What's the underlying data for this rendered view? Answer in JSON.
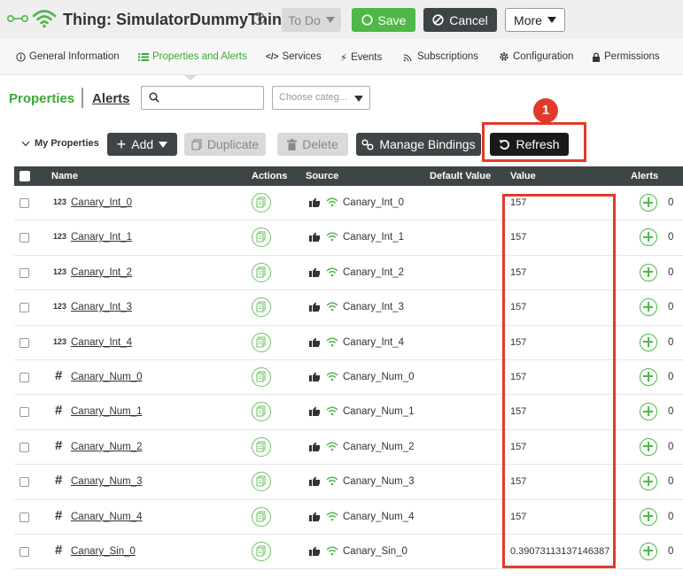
{
  "header": {
    "title": "Thing: SimulatorDummyThing",
    "help_glyph": "?",
    "todo_label": "To Do",
    "save_label": "Save",
    "cancel_label": "Cancel",
    "more_label": "More",
    "accent_color": "#4fb848",
    "dark_color": "#3f4547"
  },
  "tabs": [
    {
      "label": "General Information",
      "icon": "info-icon"
    },
    {
      "label": "Properties and Alerts",
      "icon": "list-icon",
      "active": true
    },
    {
      "label": "Services",
      "icon": "code-icon"
    },
    {
      "label": "Events",
      "icon": "bolt-icon"
    },
    {
      "label": "Subscriptions",
      "icon": "subscription-icon"
    },
    {
      "label": "Configuration",
      "icon": "gear-icon"
    },
    {
      "label": "Permissions",
      "icon": "lock-icon"
    }
  ],
  "subnav": {
    "properties_label": "Properties",
    "alerts_label": "Alerts",
    "search_value": "",
    "category_placeholder": "Choose categ..."
  },
  "toolbar": {
    "section_label": "My Properties",
    "add_label": "Add",
    "duplicate_label": "Duplicate",
    "delete_label": "Delete",
    "manage_bindings_label": "Manage Bindings",
    "refresh_label": "Refresh",
    "callout_number": "1",
    "highlight_color": "#e23a2a"
  },
  "table": {
    "columns": {
      "name": "Name",
      "actions": "Actions",
      "source": "Source",
      "default_value": "Default Value",
      "value": "Value",
      "alerts": "Alerts"
    },
    "rows": [
      {
        "type": "123",
        "name": "Canary_Int_0",
        "source": "Canary_Int_0",
        "value": "157",
        "alerts": "0"
      },
      {
        "type": "123",
        "name": "Canary_Int_1",
        "source": "Canary_Int_1",
        "value": "157",
        "alerts": "0"
      },
      {
        "type": "123",
        "name": "Canary_Int_2",
        "source": "Canary_Int_2",
        "value": "157",
        "alerts": "0"
      },
      {
        "type": "123",
        "name": "Canary_Int_3",
        "source": "Canary_Int_3",
        "value": "157",
        "alerts": "0"
      },
      {
        "type": "123",
        "name": "Canary_Int_4",
        "source": "Canary_Int_4",
        "value": "157",
        "alerts": "0"
      },
      {
        "type": "#",
        "name": "Canary_Num_0",
        "source": "Canary_Num_0",
        "value": "157",
        "alerts": "0"
      },
      {
        "type": "#",
        "name": "Canary_Num_1",
        "source": "Canary_Num_1",
        "value": "157",
        "alerts": "0"
      },
      {
        "type": "#",
        "name": "Canary_Num_2",
        "source": "Canary_Num_2",
        "value": "157",
        "alerts": "0"
      },
      {
        "type": "#",
        "name": "Canary_Num_3",
        "source": "Canary_Num_3",
        "value": "157",
        "alerts": "0"
      },
      {
        "type": "#",
        "name": "Canary_Num_4",
        "source": "Canary_Num_4",
        "value": "157",
        "alerts": "0"
      },
      {
        "type": "#",
        "name": "Canary_Sin_0",
        "source": "Canary_Sin_0",
        "value": "0.39073113137146387",
        "alerts": "0"
      }
    ]
  }
}
